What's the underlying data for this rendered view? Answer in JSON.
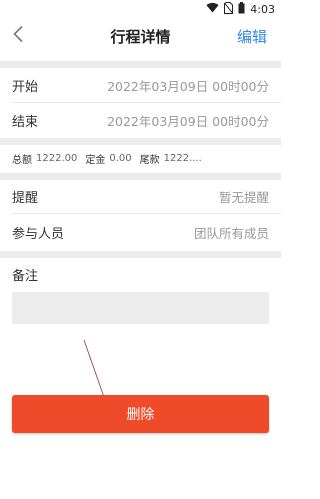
{
  "status_bar": {
    "time": "4:03",
    "icons": [
      "wifi-icon",
      "sim-off-icon",
      "battery-icon"
    ]
  },
  "header": {
    "title": "行程详情",
    "edit_label": "编辑",
    "back_icon": "chevron-left-icon"
  },
  "schedule": {
    "start_label": "开始",
    "start_value": "2022年03月09日 00时00分",
    "end_label": "结束",
    "end_value": "2022年03月09日 00时00分"
  },
  "amounts": {
    "total_label": "总额",
    "total_value": "1222.00",
    "deposit_label": "定金",
    "deposit_value": "0.00",
    "balance_label": "尾款",
    "balance_value": "1222...."
  },
  "details": {
    "reminder_label": "提醒",
    "reminder_value": "暂无提醒",
    "participants_label": "参与人员",
    "participants_value": "团队所有成员"
  },
  "notes": {
    "label": "备注",
    "value": ""
  },
  "actions": {
    "delete_label": "删除"
  },
  "colors": {
    "accent": "#2f8ae0",
    "danger": "#ef4b2b",
    "section_gap": "#ececec"
  }
}
